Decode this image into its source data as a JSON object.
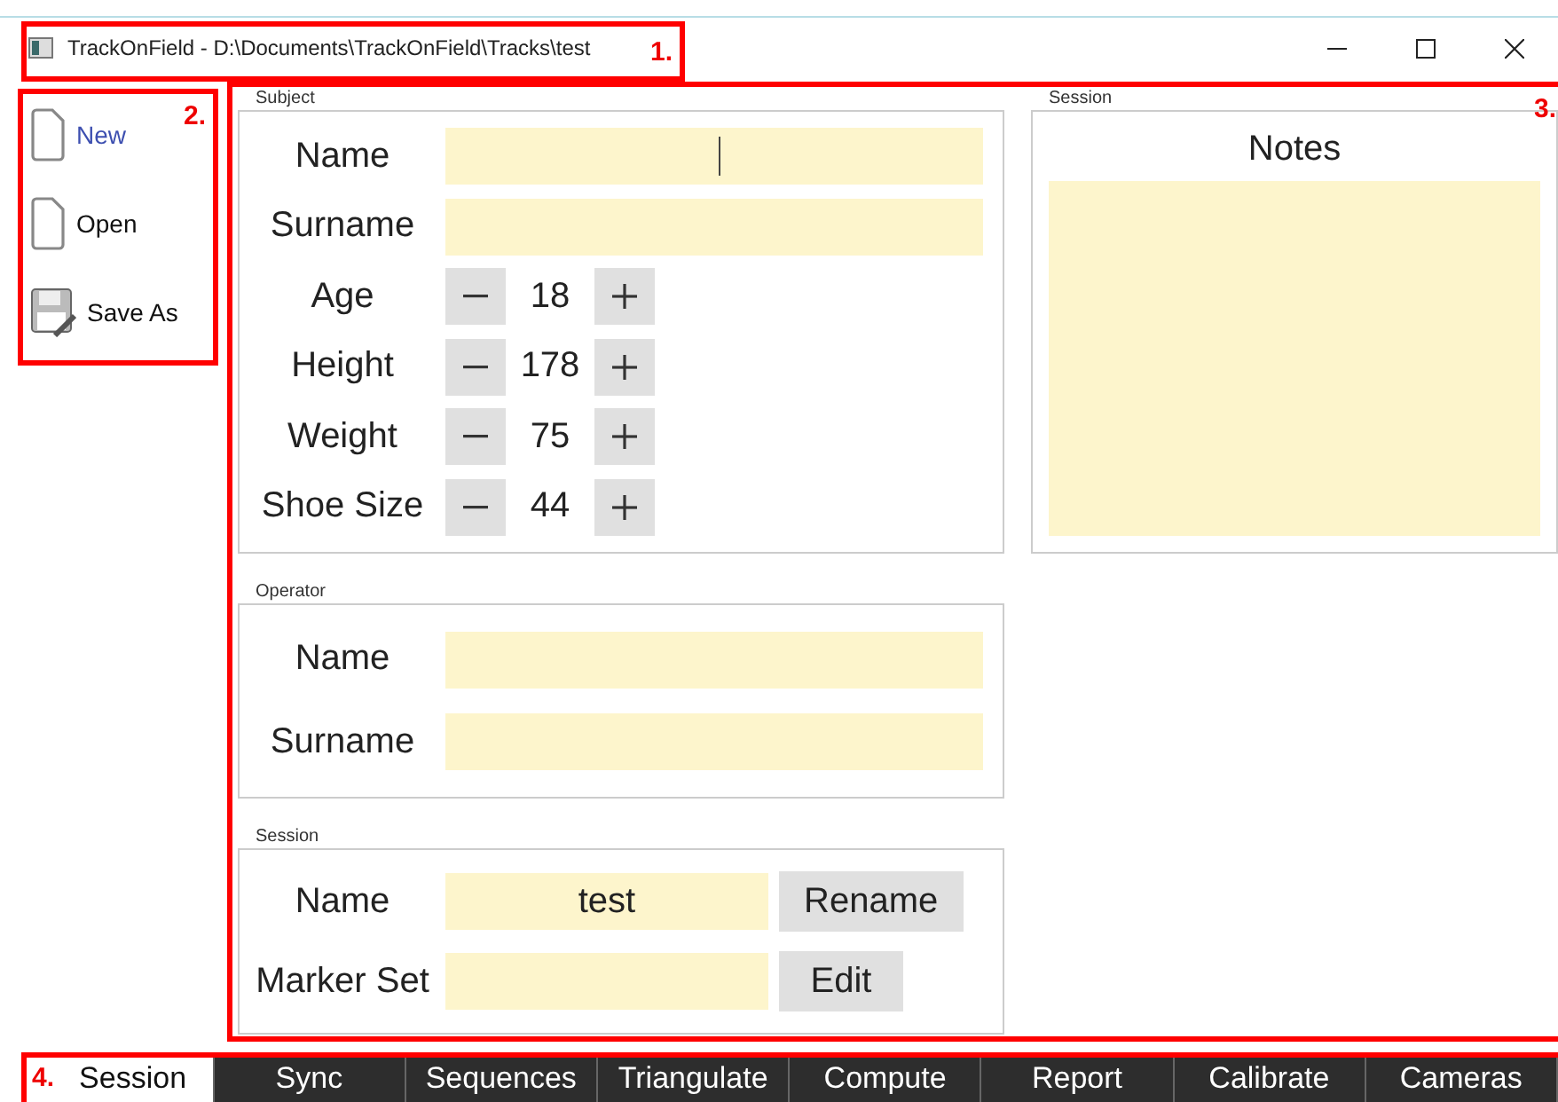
{
  "window": {
    "title": "TrackOnField - D:\\Documents\\TrackOnField\\Tracks\\test"
  },
  "sidebar": {
    "items": [
      {
        "label": "New",
        "kind": "new",
        "selected": true
      },
      {
        "label": "Open",
        "kind": "open",
        "selected": false
      },
      {
        "label": "Save As",
        "kind": "save",
        "selected": false
      }
    ]
  },
  "subject": {
    "title": "Subject",
    "fields": [
      {
        "label": "Name",
        "kind": "text",
        "focused": true
      },
      {
        "label": "Surname",
        "kind": "text",
        "focused": false
      },
      {
        "label": "Age",
        "kind": "spin",
        "value": "18"
      },
      {
        "label": "Height",
        "kind": "spin",
        "value": "178"
      },
      {
        "label": "Weight",
        "kind": "spin",
        "value": "75"
      },
      {
        "label": "Shoe Size",
        "kind": "spin",
        "value": "44"
      }
    ]
  },
  "operator": {
    "title": "Operator",
    "fields": [
      {
        "label": "Name",
        "kind": "text",
        "focused": false
      },
      {
        "label": "Surname",
        "kind": "text",
        "focused": false
      }
    ]
  },
  "session": {
    "title": "Session",
    "fields": [
      {
        "label": "Name",
        "kind": "action",
        "value": "test",
        "action": "Rename"
      },
      {
        "label": "Marker Set",
        "kind": "action",
        "action": "Edit"
      }
    ]
  },
  "notes": {
    "title": "Session",
    "heading": "Notes"
  },
  "tabs": [
    {
      "label": "Session",
      "selected": true
    },
    {
      "label": "Sync",
      "selected": false
    },
    {
      "label": "Sequences",
      "selected": false
    },
    {
      "label": "Triangulate",
      "selected": false
    },
    {
      "label": "Compute",
      "selected": false
    },
    {
      "label": "Report",
      "selected": false
    },
    {
      "label": "Calibrate",
      "selected": false
    },
    {
      "label": "Cameras",
      "selected": false
    }
  ],
  "annotations": [
    {
      "label": "1."
    },
    {
      "label": "2."
    },
    {
      "label": "3."
    },
    {
      "label": "4."
    }
  ]
}
